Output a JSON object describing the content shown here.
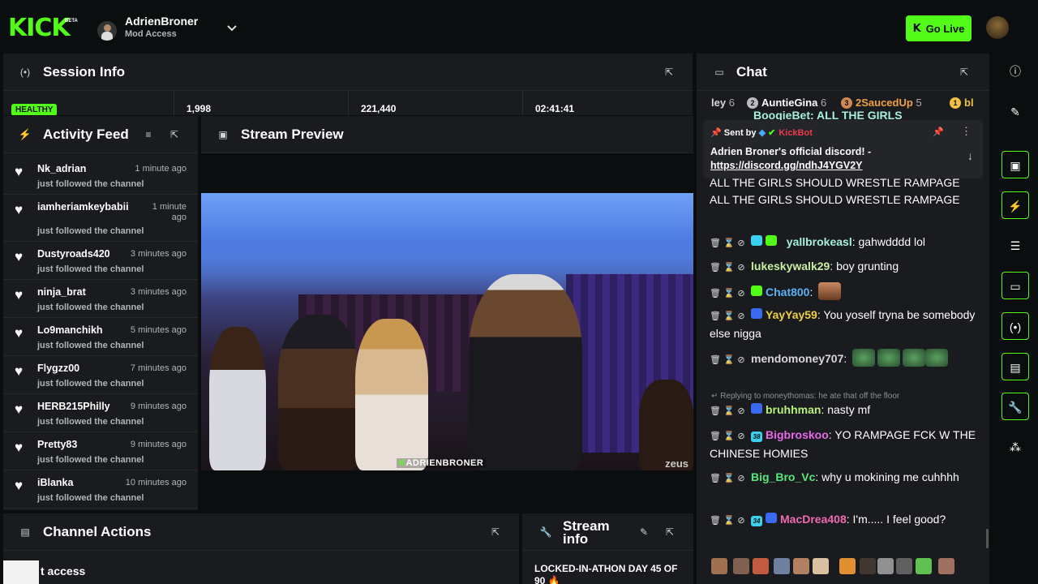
{
  "topbar": {
    "logo": "KICK",
    "logo_badge": "BETA",
    "channel_name": "AdrienBroner",
    "channel_role": "Mod Access",
    "go_live_label": "Go Live"
  },
  "session": {
    "title": "Session Info",
    "health": "HEALTHY",
    "viewers": "1,998",
    "followers": "221,440",
    "uptime": "02:41:41"
  },
  "activity": {
    "title": "Activity Feed",
    "items": [
      {
        "name": "Nk_adrian",
        "time": "1 minute ago",
        "desc": "just followed the channel"
      },
      {
        "name": "iamheriamkeybabii",
        "time": "1 minute ago",
        "desc": "just followed the channel"
      },
      {
        "name": "Dustyroads420",
        "time": "3 minutes ago",
        "desc": "just followed the channel"
      },
      {
        "name": "ninja_brat",
        "time": "3 minutes ago",
        "desc": "just followed the channel"
      },
      {
        "name": "Lo9manchikh",
        "time": "5 minutes ago",
        "desc": "just followed the channel"
      },
      {
        "name": "Flygzz00",
        "time": "7 minutes ago",
        "desc": "just followed the channel"
      },
      {
        "name": "HERB215Philly",
        "time": "9 minutes ago",
        "desc": "just followed the channel"
      },
      {
        "name": "Pretty83",
        "time": "9 minutes ago",
        "desc": "just followed the channel"
      },
      {
        "name": "iBlanka",
        "time": "10 minutes ago",
        "desc": "just followed the channel"
      }
    ]
  },
  "preview": {
    "title": "Stream Preview",
    "overlay_k": "K",
    "overlay_name": "ADRIENBRONER",
    "watermark": "zeus"
  },
  "actions": {
    "title": "Channel Actions",
    "item_partial": "t access"
  },
  "stream_info": {
    "title_line1": "Stream",
    "title_line2": "info",
    "text": "LOCKED-IN-ATHON DAY 45 OF 90 🔥"
  },
  "chat": {
    "title": "Chat",
    "leaderboard": [
      {
        "name": "ley",
        "count": "6"
      },
      {
        "rank": "2",
        "name": "AuntieGina",
        "count": "6"
      },
      {
        "rank": "3",
        "name": "2SaucedUp",
        "count": "5"
      },
      {
        "rank": "1",
        "name": "bl",
        "count": ""
      }
    ],
    "pinned": {
      "sent_by": "Sent by",
      "bot": "KickBot",
      "message": "Adrien Broner's official discord! -",
      "link": "https://discord.gg/ndhJ4YGV2Y"
    },
    "partial_top": "BooqieBet: ALL THE GIRLS",
    "spam_text": "ALL THE GIRLS SHOULD WRESTLE RAMPAGE ALL THE GIRLS SHOULD WRESTLE RAMPAGE",
    "messages": [
      {
        "user": "yallbrokeasl",
        "color": "#a6f0d8",
        "text": "gahwdddd lol"
      },
      {
        "user": "lukeskywalk29",
        "color": "#c8f0a0",
        "text": "boy grunting"
      },
      {
        "user": "Chat800",
        "color": "#5ab0f0",
        "text": ""
      },
      {
        "user": "YayYay59",
        "color": "#f0d040",
        "text": "You yoself tryna be somebody else nigga"
      },
      {
        "user": "mendomoney707",
        "color": "#d8d8d8",
        "text": ""
      },
      {
        "reply": "Replying to moneythomas: he ate that off the floor"
      },
      {
        "user": "bruhhman",
        "color": "#b8f078",
        "text": "nasty mf"
      },
      {
        "user": "Bigbroskoo",
        "color": "#e86ae8",
        "text": "YO RAMPAGE FCK W THE CHINESE HOMIES"
      },
      {
        "user": "Big_Bro_Vc",
        "color": "#58e878",
        "text": "why u mokining me cuhhhh"
      },
      {
        "user": "MacDrea408",
        "color": "#f06ab0",
        "text": "I'm..... I feel good?"
      }
    ],
    "sub_badges": {
      "bigbroskoo": "38",
      "macdrea": "34"
    }
  },
  "colors": {
    "accent": "#53fc18",
    "panel": "#191b1f",
    "background": "#0b0e0f",
    "kickbot": "#e83a4d"
  }
}
